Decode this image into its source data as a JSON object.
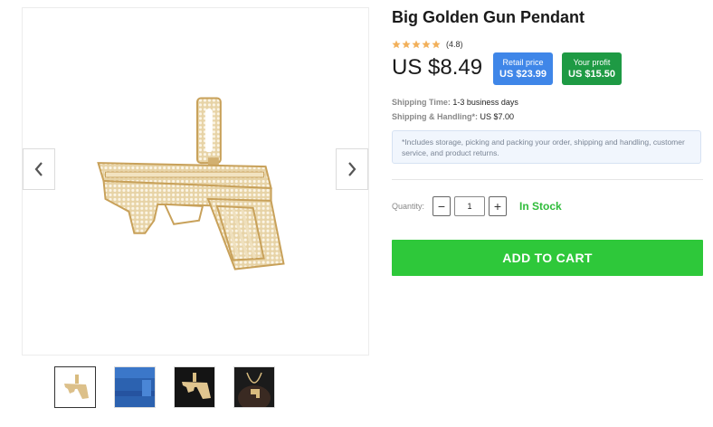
{
  "product": {
    "title": "Big Golden Gun Pendant",
    "rating_text": "(4.8)",
    "rating_value": 4.8,
    "price": "US $8.49"
  },
  "badges": {
    "retail_label": "Retail price",
    "retail_value": "US $23.99",
    "retail_color": "#3f86e8",
    "profit_label": "Your profit",
    "profit_value": "US $15.50",
    "profit_color": "#1e9a44"
  },
  "shipping": {
    "time_label": "Shipping Time:",
    "time_value": "1-3 business days",
    "handling_label": "Shipping & Handling*:",
    "handling_value": "US $7.00"
  },
  "note": "*Includes storage, picking and packing your order, shipping and handling, customer service, and product returns.",
  "quantity": {
    "label": "Quantity:",
    "value": "1",
    "minus": "−",
    "plus": "+"
  },
  "stock_status": "In Stock",
  "cart_button": "ADD TO CART",
  "colors": {
    "accent_green": "#2ec83a",
    "star": "#f2b05a"
  },
  "icons": {
    "prev": "chevron-left-icon",
    "next": "chevron-right-icon",
    "star": "star-icon"
  }
}
